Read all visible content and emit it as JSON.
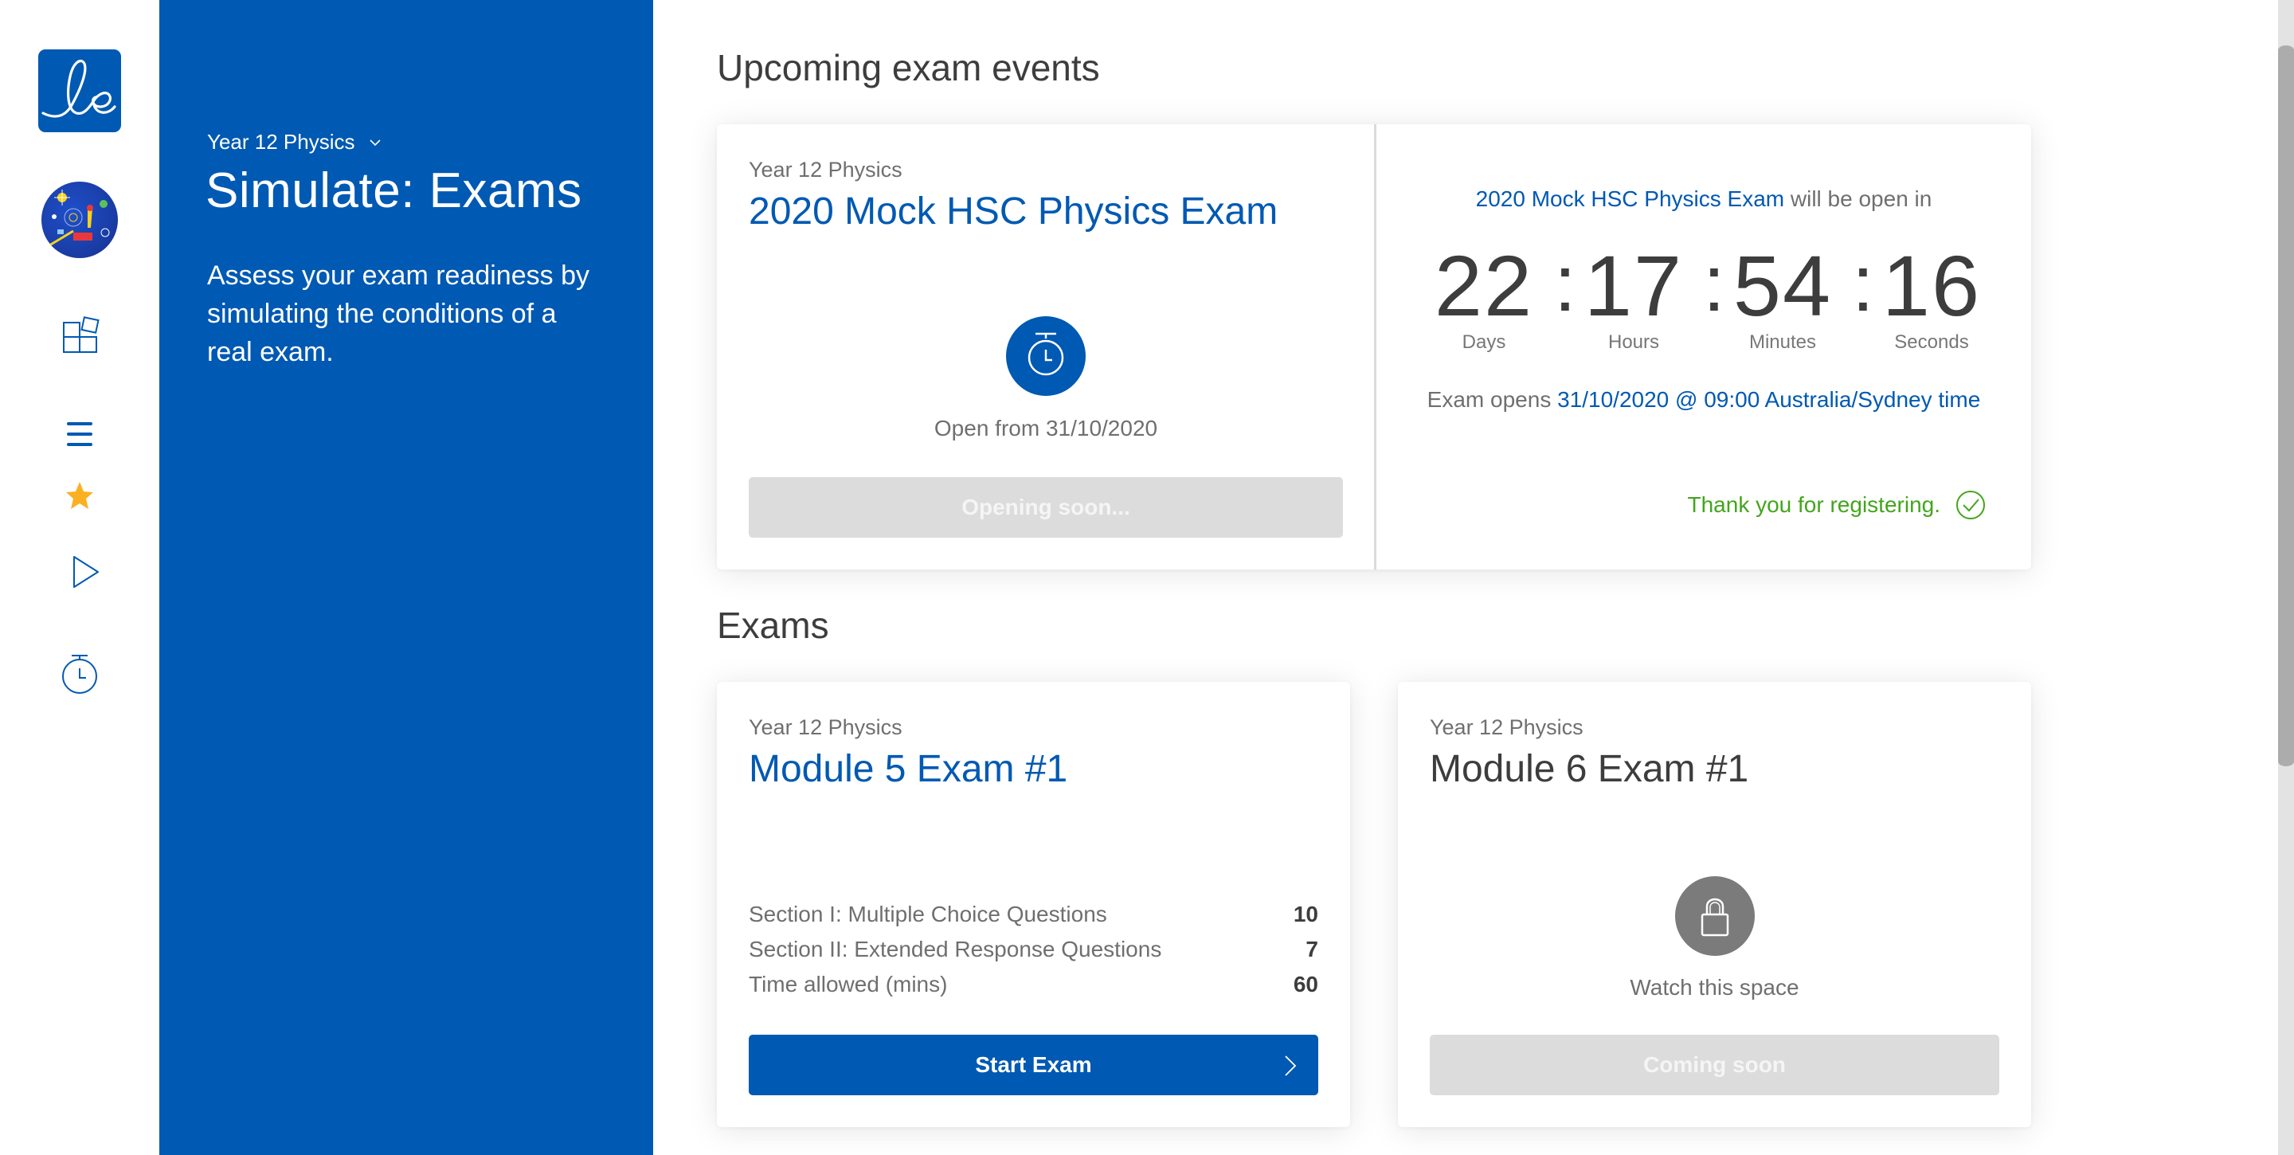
{
  "rail": {
    "logo_text": "le",
    "nav_items": [
      {
        "name": "dashboard",
        "icon": "grid-icon"
      },
      {
        "name": "list",
        "icon": "hamburger-icon"
      },
      {
        "name": "favourites",
        "icon": "star-icon"
      },
      {
        "name": "play",
        "icon": "play-icon"
      },
      {
        "name": "exams",
        "icon": "stopwatch-icon"
      }
    ]
  },
  "panel": {
    "course_selector": "Year 12 Physics",
    "title": "Simulate: Exams",
    "description": "Assess your exam readiness by simulating the conditions of a real exam."
  },
  "upcoming": {
    "heading": "Upcoming exam events",
    "event": {
      "course": "Year 12 Physics",
      "title": "2020 Mock HSC Physics Exam",
      "open_from": "Open from 31/10/2020",
      "button_label": "Opening soon...",
      "will_open_link": "2020 Mock HSC Physics Exam",
      "will_open_suffix": " will be open in",
      "countdown": [
        {
          "value": "22",
          "label": "Days"
        },
        {
          "value": "17",
          "label": "Hours"
        },
        {
          "value": "54",
          "label": "Minutes"
        },
        {
          "value": "16",
          "label": "Seconds"
        }
      ],
      "separator": ":",
      "opens_prefix": "Exam opens ",
      "opens_value": "31/10/2020 @ 09:00 Australia/Sydney time",
      "registered_text": "Thank you for registering."
    }
  },
  "exams": {
    "heading": "Exams",
    "items": [
      {
        "course": "Year 12 Physics",
        "title": "Module 5 Exam #1",
        "stats": [
          {
            "label": "Section I: Multiple Choice Questions",
            "value": "10"
          },
          {
            "label": "Section II: Extended Response Questions",
            "value": "7"
          },
          {
            "label": "Time allowed (mins)",
            "value": "60"
          }
        ],
        "button_label": "Start Exam"
      },
      {
        "course": "Year 12 Physics",
        "title": "Module 6 Exam #1",
        "caption": "Watch this space",
        "button_label": "Coming soon"
      }
    ]
  },
  "colors": {
    "brand_blue": "#0059b3",
    "success_green": "#43a51c",
    "star_gold": "#fbb022",
    "disabled_gray": "#dcdcdc"
  }
}
